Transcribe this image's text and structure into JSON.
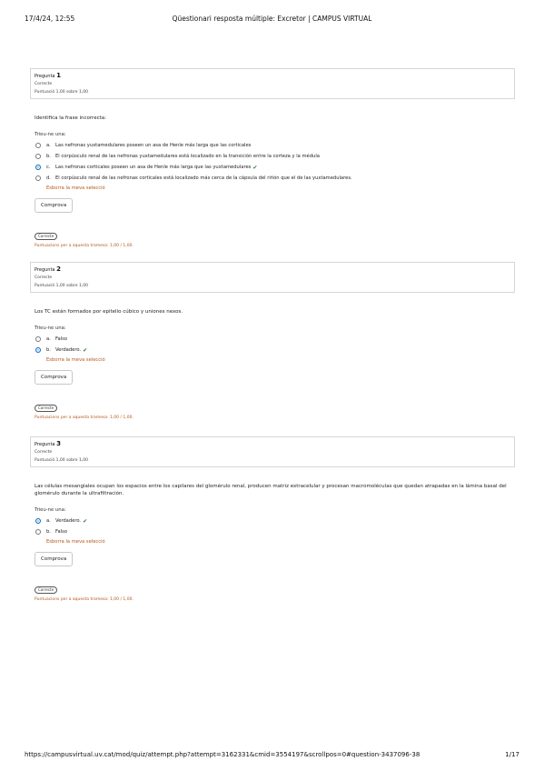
{
  "print_header": {
    "datetime": "17/4/24, 12:55",
    "title": "Qüestionari resposta múltiple: Excretor | CAMPUS VIRTUAL"
  },
  "print_footer": {
    "url": "https://campusvirtual.uv.cat/mod/quiz/attempt.php?attempt=3162331&cmid=3554197&scrollpos=0#question-3437096-38",
    "page": "1/17"
  },
  "questions": [
    {
      "label": "Pregunta",
      "number": "1",
      "state": "Correcte",
      "grade": "Puntuació 1,00 sobre 1,00",
      "text": "Identifica la frase incorrecta:",
      "prompt": "Trieu-ne una:",
      "options": [
        {
          "letter": "a.",
          "text": "Las nefronas yuxtamedulares poseen un asa de Henle más larga que las corticales",
          "checked": false,
          "correct": ""
        },
        {
          "letter": "b.",
          "text": "El corpúsculo renal de las nefronas yuxtamedulares está localizado en la transición entre la corteza y la médula",
          "checked": false,
          "correct": ""
        },
        {
          "letter": "c.",
          "text": "Las nefronas corticales poseen un asa de Henle más larga que las yuxtamedulares",
          "checked": true,
          "correct": "✔"
        },
        {
          "letter": "d.",
          "text": "El corpúsculo renal de las nefronas corticales está localizado más cerca de la cápsula del riñón que el de las yuxtamedulares.",
          "checked": false,
          "correct": ""
        }
      ],
      "clear": "Esborra la meva selecció",
      "button": "Comprova",
      "pill": "Correcte",
      "mark_note": "Puntuacions per a aquesta tramesa: 1,00 / 1,00."
    },
    {
      "label": "Pregunta",
      "number": "2",
      "state": "Correcte",
      "grade": "Puntuació 1,00 sobre 1,00",
      "text": "Los TC están formados por epitelio cúbico y uniones nexos.",
      "prompt": "Trieu-ne una:",
      "options": [
        {
          "letter": "a.",
          "text": "Falso",
          "checked": false,
          "correct": ""
        },
        {
          "letter": "b.",
          "text": "Verdadero.",
          "checked": true,
          "correct": "✔"
        }
      ],
      "clear": "Esborra la meva selecció",
      "button": "Comprova",
      "pill": "Correcte",
      "mark_note": "Puntuacions per a aquesta tramesa: 1,00 / 1,00."
    },
    {
      "label": "Pregunta",
      "number": "3",
      "state": "Correcte",
      "grade": "Puntuació 1,00 sobre 1,00",
      "text": "Las células mesangiales ocupan los espacios entre los capilares del glomérulo renal, producen matriz extracelular y procesan macromoléculas que quedan atrapadas en la lámina basal del glomérulo durante la ultrafiltración.",
      "prompt": "Trieu-ne una:",
      "options": [
        {
          "letter": "a.",
          "text": "Verdadero.",
          "checked": true,
          "correct": "✔"
        },
        {
          "letter": "b.",
          "text": "Falso",
          "checked": false,
          "correct": ""
        }
      ],
      "clear": "Esborra la meva selecció",
      "button": "Comprova",
      "pill": "Correcte",
      "mark_note": "Puntuacions per a aquesta tramesa: 1,00 / 1,00."
    }
  ]
}
